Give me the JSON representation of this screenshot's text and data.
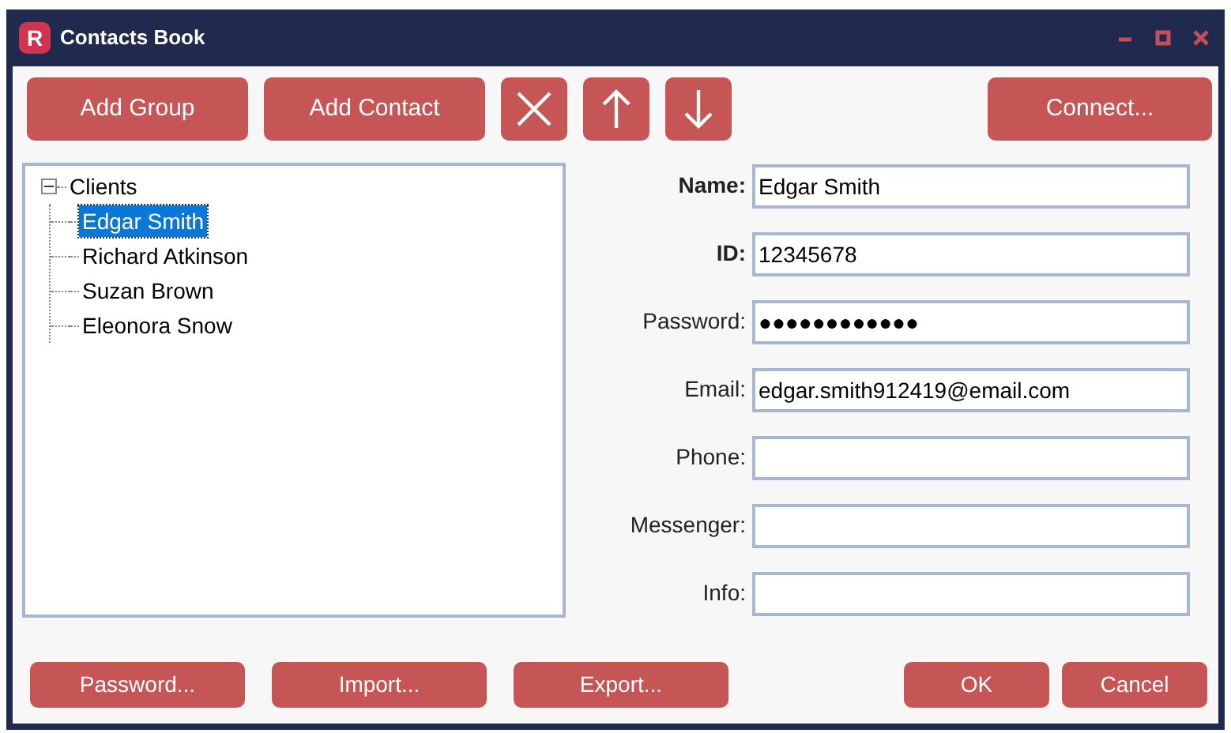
{
  "window": {
    "logo": "R",
    "title": "Contacts Book"
  },
  "toolbar": {
    "left": [
      {
        "kind": "text",
        "label": "Add Group"
      },
      {
        "kind": "text",
        "label": "Add Contact"
      },
      {
        "kind": "delete"
      },
      {
        "kind": "up"
      },
      {
        "kind": "down"
      }
    ],
    "right": [
      {
        "kind": "text",
        "label": "Connect..."
      }
    ]
  },
  "tree": [
    {
      "label": "Clients",
      "expanded": true,
      "selected": false,
      "children": [
        {
          "label": "Edgar Smith",
          "selected": true
        },
        {
          "label": "Richard Atkinson",
          "selected": false
        },
        {
          "label": "Suzan Brown",
          "selected": false
        },
        {
          "label": "Eleonora Snow",
          "selected": false
        }
      ]
    }
  ],
  "form": [
    {
      "label": "Name:",
      "bold": true,
      "value": "Edgar Smith"
    },
    {
      "label": "ID:",
      "bold": true,
      "value": "12345678"
    },
    {
      "label": "Password:",
      "bold": false,
      "value": "●●●●●●●●●●●●"
    },
    {
      "label": "Email:",
      "bold": false,
      "value": "edgar.smith912419@email.com"
    },
    {
      "label": "Phone:",
      "bold": false
    },
    {
      "label": "Messenger:",
      "bold": false
    },
    {
      "label": "Info:",
      "bold": false
    }
  ],
  "footer": {
    "left": [
      "Password...",
      "Import...",
      "Export..."
    ],
    "right": [
      "OK",
      "Cancel"
    ]
  }
}
